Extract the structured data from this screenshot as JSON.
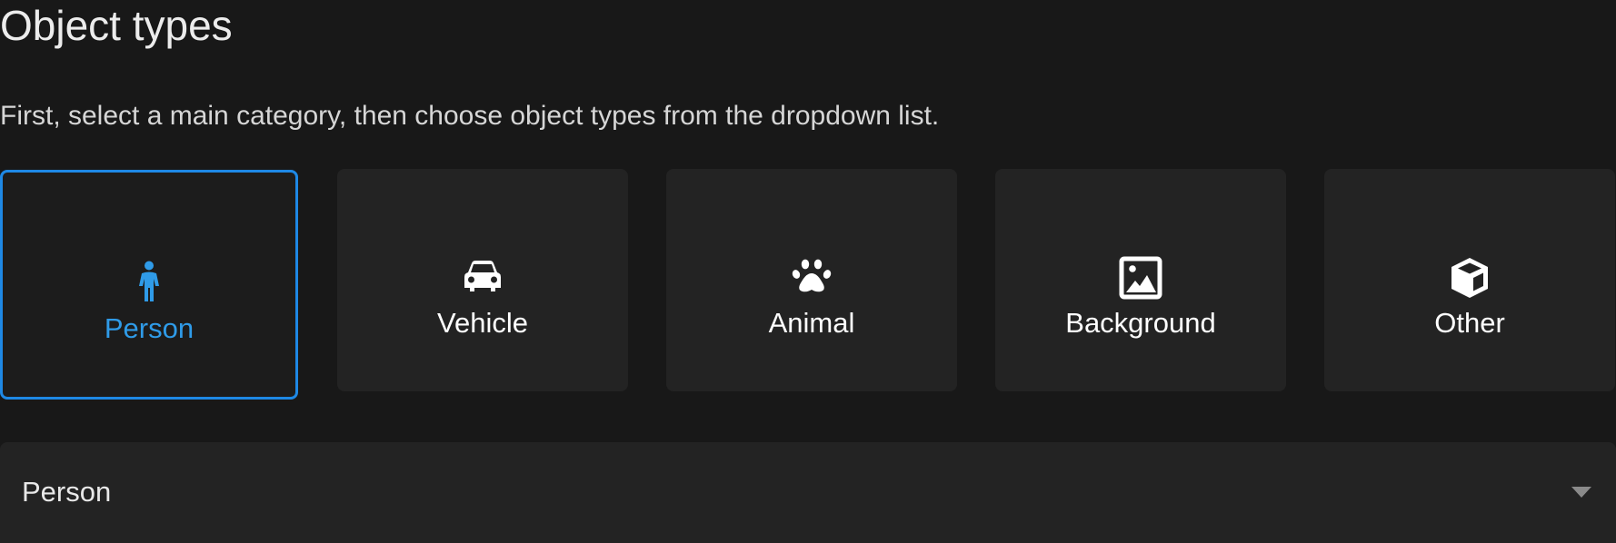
{
  "header": {
    "title": "Object types",
    "description": "First, select a main category, then choose object types from the dropdown list."
  },
  "categories": [
    {
      "label": "Person",
      "icon": "person-icon",
      "selected": true
    },
    {
      "label": "Vehicle",
      "icon": "car-icon",
      "selected": false
    },
    {
      "label": "Animal",
      "icon": "paw-icon",
      "selected": false
    },
    {
      "label": "Background",
      "icon": "image-icon",
      "selected": false
    },
    {
      "label": "Other",
      "icon": "cube-icon",
      "selected": false
    }
  ],
  "dropdown": {
    "value": "Person",
    "icon": "chevron-down-icon"
  },
  "colors": {
    "background": "#181818",
    "card": "#232323",
    "accent": "#1e88e5",
    "selected_text": "#2f9be8"
  }
}
